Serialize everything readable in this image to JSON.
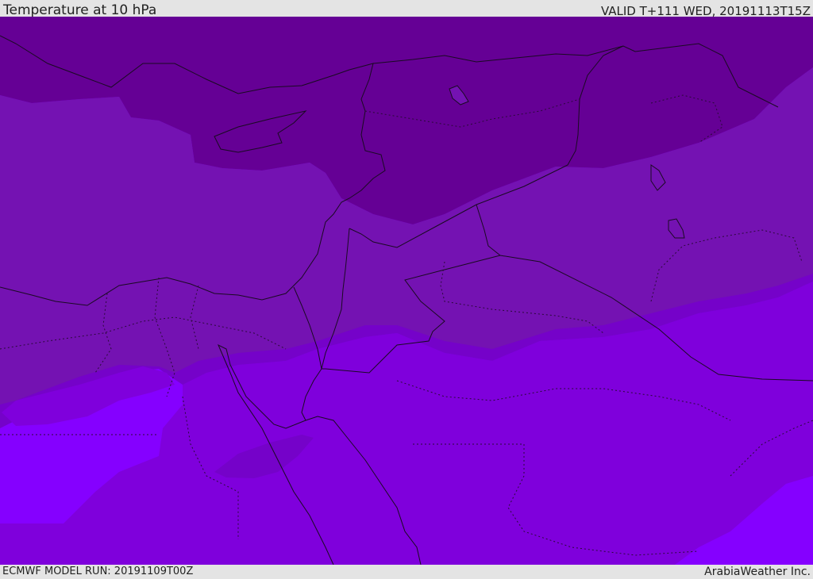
{
  "header": {
    "title": "Temperature at 10 hPa",
    "valid": "VALID T+111 WED, 20191113T15Z"
  },
  "footer": {
    "model_run": "ECMWF MODEL RUN: 20191109T00Z",
    "credit": "ArabiaWeather Inc."
  },
  "map": {
    "shading_bands": [
      {
        "band": "coldest",
        "color": "#650095"
      },
      {
        "band": "cold",
        "color": "#7412b2"
      },
      {
        "band": "mid",
        "color": "#7502c9"
      },
      {
        "band": "mild",
        "color": "#7f00dc"
      },
      {
        "band": "warm",
        "color": "#8500ff"
      }
    ],
    "border_color": "#1a0a22"
  }
}
